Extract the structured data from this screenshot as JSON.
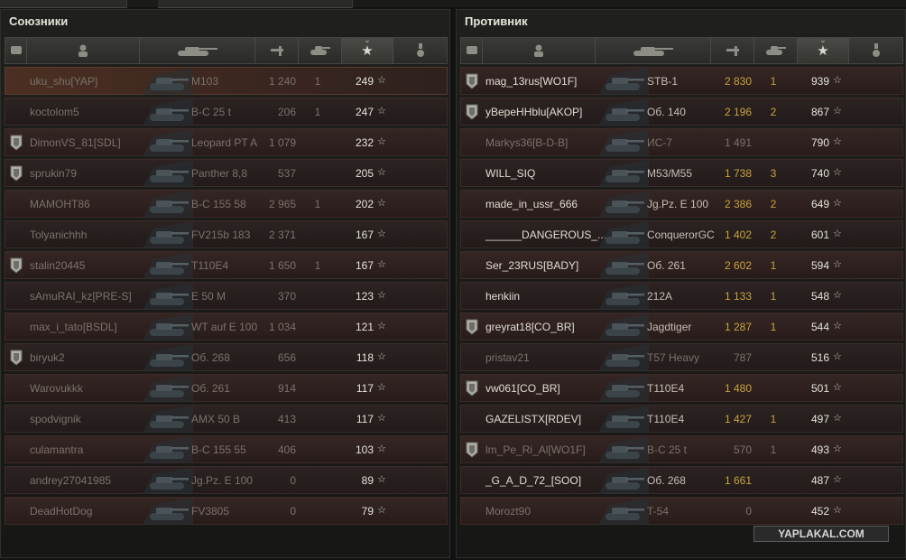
{
  "allies": {
    "title": "Союзники",
    "rows": [
      {
        "name": "uku_shu[YAP]",
        "tank": "M103",
        "damage": "1 240",
        "kills": "1",
        "xp": "249",
        "badge": false,
        "dead": true,
        "highlight": true
      },
      {
        "name": "koctolom5",
        "tank": "B-C 25 t",
        "damage": "206",
        "kills": "1",
        "xp": "247",
        "badge": false,
        "dead": true
      },
      {
        "name": "DimonVS_81[SDL]",
        "tank": "Leopard PT A",
        "damage": "1 079",
        "kills": "",
        "xp": "232",
        "badge": true,
        "dead": true
      },
      {
        "name": "sprukin79",
        "tank": "Panther 8,8",
        "damage": "537",
        "kills": "",
        "xp": "205",
        "badge": true,
        "dead": true
      },
      {
        "name": "MAMOHT86",
        "tank": "B-C 155 58",
        "damage": "2 965",
        "kills": "1",
        "xp": "202",
        "badge": false,
        "dead": true
      },
      {
        "name": "Tolyanichhh",
        "tank": "FV215b 183",
        "damage": "2 371",
        "kills": "",
        "xp": "167",
        "badge": false,
        "dead": true
      },
      {
        "name": "stalin20445",
        "tank": "T110E4",
        "damage": "1 650",
        "kills": "1",
        "xp": "167",
        "badge": true,
        "dead": true
      },
      {
        "name": "sAmuRAI_kz[PRE-S]",
        "tank": "E 50 M",
        "damage": "370",
        "kills": "",
        "xp": "123",
        "badge": false,
        "dead": true
      },
      {
        "name": "max_i_tato[BSDL]",
        "tank": "WT auf E 100",
        "damage": "1 034",
        "kills": "",
        "xp": "121",
        "badge": false,
        "dead": true
      },
      {
        "name": "biryuk2",
        "tank": "Об. 268",
        "damage": "656",
        "kills": "",
        "xp": "118",
        "badge": true,
        "dead": true
      },
      {
        "name": "Warovukkk",
        "tank": "Об. 261",
        "damage": "914",
        "kills": "",
        "xp": "117",
        "badge": false,
        "dead": true
      },
      {
        "name": "spodvignik",
        "tank": "AMX 50 B",
        "damage": "413",
        "kills": "",
        "xp": "117",
        "badge": false,
        "dead": true
      },
      {
        "name": "culamantra",
        "tank": "B-C 155 55",
        "damage": "406",
        "kills": "",
        "xp": "103",
        "badge": false,
        "dead": true
      },
      {
        "name": "andrey27041985",
        "tank": "Jg.Pz. E 100",
        "damage": "0",
        "kills": "",
        "xp": "89",
        "badge": false,
        "dead": true
      },
      {
        "name": "DeadHotDog",
        "tank": "FV3805",
        "damage": "0",
        "kills": "",
        "xp": "79",
        "badge": false,
        "dead": true
      }
    ]
  },
  "enemies": {
    "title": "Противник",
    "rows": [
      {
        "name": "mag_13rus[WO1F]",
        "tank": "STB-1",
        "damage": "2 830",
        "kills": "1",
        "xp": "939",
        "badge": true,
        "dead": false
      },
      {
        "name": "yBepeHHblu[AKOP]",
        "tank": "Об. 140",
        "damage": "2 196",
        "kills": "2",
        "xp": "867",
        "badge": true,
        "dead": false
      },
      {
        "name": "Markys36[B-D-B]",
        "tank": "ИС-7",
        "damage": "1 491",
        "kills": "",
        "xp": "790",
        "badge": false,
        "dead": true
      },
      {
        "name": "WILL_SIQ",
        "tank": "M53/M55",
        "damage": "1 738",
        "kills": "3",
        "xp": "740",
        "badge": false,
        "dead": false
      },
      {
        "name": "made_in_ussr_666",
        "tank": "Jg.Pz. E 100",
        "damage": "2 386",
        "kills": "2",
        "xp": "649",
        "badge": false,
        "dead": false
      },
      {
        "name": "______DANGEROUS_...",
        "tank": "ConquerorGC",
        "damage": "1 402",
        "kills": "2",
        "xp": "601",
        "badge": false,
        "dead": false
      },
      {
        "name": "Ser_23RUS[BADY]",
        "tank": "Об. 261",
        "damage": "2 602",
        "kills": "1",
        "xp": "594",
        "badge": false,
        "dead": false
      },
      {
        "name": "henkiin",
        "tank": "212A",
        "damage": "1 133",
        "kills": "1",
        "xp": "548",
        "badge": false,
        "dead": false
      },
      {
        "name": "greyrat18[CO_BR]",
        "tank": "Jagdtiger",
        "damage": "1 287",
        "kills": "1",
        "xp": "544",
        "badge": true,
        "dead": false
      },
      {
        "name": "pristav21",
        "tank": "T57 Heavy",
        "damage": "787",
        "kills": "",
        "xp": "516",
        "badge": false,
        "dead": true
      },
      {
        "name": "vw061[CO_BR]",
        "tank": "T110E4",
        "damage": "1 480",
        "kills": "",
        "xp": "501",
        "badge": true,
        "dead": false
      },
      {
        "name": "GAZELISTX[RDEV]",
        "tank": "T110E4",
        "damage": "1 427",
        "kills": "1",
        "xp": "497",
        "badge": false,
        "dead": false
      },
      {
        "name": "lm_Pe_Ri_Al[WO1F]",
        "tank": "B-C 25 t",
        "damage": "570",
        "kills": "1",
        "xp": "493",
        "badge": true,
        "dead": true
      },
      {
        "name": "_G_A_D_72_[SOO]",
        "tank": "Об. 268",
        "damage": "1 661",
        "kills": "",
        "xp": "487",
        "badge": false,
        "dead": false
      },
      {
        "name": "Morozt90",
        "tank": "T-54",
        "damage": "0",
        "kills": "",
        "xp": "452",
        "badge": false,
        "dead": true
      }
    ]
  },
  "watermark": "YAPLAKAL.COM",
  "colors": {
    "accent": "#c9a23c",
    "row_bg": "#2b1f1d",
    "text": "#c6beb6"
  }
}
